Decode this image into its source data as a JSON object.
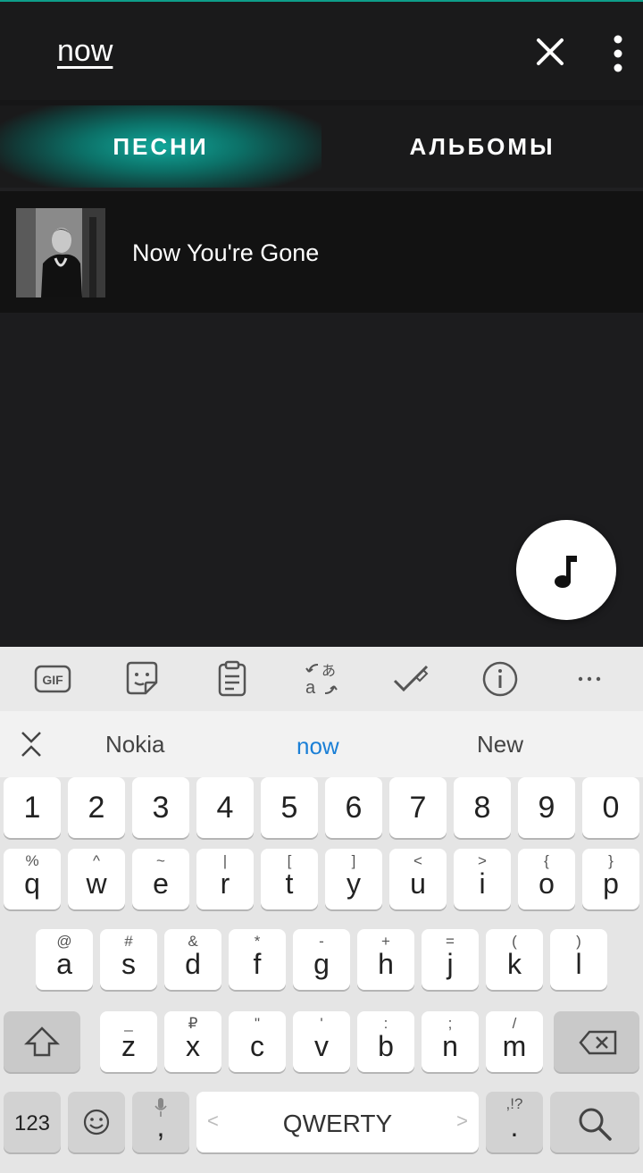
{
  "search": {
    "query": "now"
  },
  "tabs": [
    {
      "label": "ПЕСНИ"
    },
    {
      "label": "АЛЬБОМЫ"
    }
  ],
  "results": [
    {
      "title": "Now You're Gone"
    }
  ],
  "icons": {
    "close": "close-icon",
    "more": "more-vertical-icon",
    "fab": "music-note-icon"
  },
  "colors": {
    "accent": "#0e9e8a",
    "suggestion_highlight": "#1a7fd6"
  },
  "keyboard": {
    "toolbar": [
      "gif-icon",
      "sticker-icon",
      "clipboard-icon",
      "translate-icon",
      "spellcheck-icon",
      "info-icon",
      "more-horizontal-icon"
    ],
    "toolbar_text": {
      "gif": "GIF",
      "more": "···"
    },
    "suggestions": [
      "Nokia",
      "now",
      "New"
    ],
    "number_row": [
      "1",
      "2",
      "3",
      "4",
      "5",
      "6",
      "7",
      "8",
      "9",
      "0"
    ],
    "row1": [
      {
        "k": "q",
        "a": "%"
      },
      {
        "k": "w",
        "a": "^"
      },
      {
        "k": "e",
        "a": "~"
      },
      {
        "k": "r",
        "a": "|"
      },
      {
        "k": "t",
        "a": "["
      },
      {
        "k": "y",
        "a": "]"
      },
      {
        "k": "u",
        "a": "<"
      },
      {
        "k": "i",
        "a": ">"
      },
      {
        "k": "o",
        "a": "{"
      },
      {
        "k": "p",
        "a": "}"
      }
    ],
    "row2": [
      {
        "k": "a",
        "a": "@"
      },
      {
        "k": "s",
        "a": "#"
      },
      {
        "k": "d",
        "a": "&"
      },
      {
        "k": "f",
        "a": "*"
      },
      {
        "k": "g",
        "a": "-"
      },
      {
        "k": "h",
        "a": "+"
      },
      {
        "k": "j",
        "a": "="
      },
      {
        "k": "k",
        "a": "("
      },
      {
        "k": "l",
        "a": ")"
      }
    ],
    "row3": [
      {
        "k": "z",
        "a": "_"
      },
      {
        "k": "x",
        "a": "₽"
      },
      {
        "k": "c",
        "a": "\""
      },
      {
        "k": "v",
        "a": "'"
      },
      {
        "k": "b",
        "a": ":"
      },
      {
        "k": "n",
        "a": ";"
      },
      {
        "k": "m",
        "a": "/"
      }
    ],
    "bottom": {
      "symbols": "123",
      "comma": ",",
      "space": "QWERTY",
      "period": ".",
      "period_alt": ",!?"
    }
  }
}
